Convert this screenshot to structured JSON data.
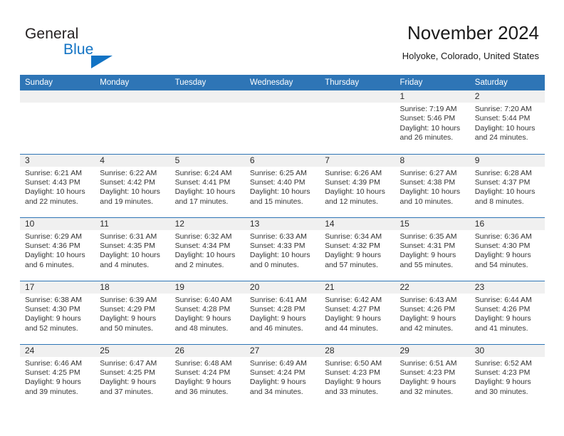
{
  "brand": {
    "name_part1": "General",
    "name_part2": "Blue",
    "triangle_icon": "blue-triangle-logo-mark",
    "accent_color": "#1273c4"
  },
  "header": {
    "title": "November 2024",
    "location": "Holyoke, Colorado, United States",
    "header_bg_color": "#2e75b6",
    "daynum_bg_color": "#f0f0f0"
  },
  "weekdays": [
    "Sunday",
    "Monday",
    "Tuesday",
    "Wednesday",
    "Thursday",
    "Friday",
    "Saturday"
  ],
  "weeks": [
    [
      {
        "day": "",
        "sunrise": "",
        "sunset": "",
        "daylight1": "",
        "daylight2": ""
      },
      {
        "day": "",
        "sunrise": "",
        "sunset": "",
        "daylight1": "",
        "daylight2": ""
      },
      {
        "day": "",
        "sunrise": "",
        "sunset": "",
        "daylight1": "",
        "daylight2": ""
      },
      {
        "day": "",
        "sunrise": "",
        "sunset": "",
        "daylight1": "",
        "daylight2": ""
      },
      {
        "day": "",
        "sunrise": "",
        "sunset": "",
        "daylight1": "",
        "daylight2": ""
      },
      {
        "day": "1",
        "sunrise": "Sunrise: 7:19 AM",
        "sunset": "Sunset: 5:46 PM",
        "daylight1": "Daylight: 10 hours",
        "daylight2": "and 26 minutes."
      },
      {
        "day": "2",
        "sunrise": "Sunrise: 7:20 AM",
        "sunset": "Sunset: 5:44 PM",
        "daylight1": "Daylight: 10 hours",
        "daylight2": "and 24 minutes."
      }
    ],
    [
      {
        "day": "3",
        "sunrise": "Sunrise: 6:21 AM",
        "sunset": "Sunset: 4:43 PM",
        "daylight1": "Daylight: 10 hours",
        "daylight2": "and 22 minutes."
      },
      {
        "day": "4",
        "sunrise": "Sunrise: 6:22 AM",
        "sunset": "Sunset: 4:42 PM",
        "daylight1": "Daylight: 10 hours",
        "daylight2": "and 19 minutes."
      },
      {
        "day": "5",
        "sunrise": "Sunrise: 6:24 AM",
        "sunset": "Sunset: 4:41 PM",
        "daylight1": "Daylight: 10 hours",
        "daylight2": "and 17 minutes."
      },
      {
        "day": "6",
        "sunrise": "Sunrise: 6:25 AM",
        "sunset": "Sunset: 4:40 PM",
        "daylight1": "Daylight: 10 hours",
        "daylight2": "and 15 minutes."
      },
      {
        "day": "7",
        "sunrise": "Sunrise: 6:26 AM",
        "sunset": "Sunset: 4:39 PM",
        "daylight1": "Daylight: 10 hours",
        "daylight2": "and 12 minutes."
      },
      {
        "day": "8",
        "sunrise": "Sunrise: 6:27 AM",
        "sunset": "Sunset: 4:38 PM",
        "daylight1": "Daylight: 10 hours",
        "daylight2": "and 10 minutes."
      },
      {
        "day": "9",
        "sunrise": "Sunrise: 6:28 AM",
        "sunset": "Sunset: 4:37 PM",
        "daylight1": "Daylight: 10 hours",
        "daylight2": "and 8 minutes."
      }
    ],
    [
      {
        "day": "10",
        "sunrise": "Sunrise: 6:29 AM",
        "sunset": "Sunset: 4:36 PM",
        "daylight1": "Daylight: 10 hours",
        "daylight2": "and 6 minutes."
      },
      {
        "day": "11",
        "sunrise": "Sunrise: 6:31 AM",
        "sunset": "Sunset: 4:35 PM",
        "daylight1": "Daylight: 10 hours",
        "daylight2": "and 4 minutes."
      },
      {
        "day": "12",
        "sunrise": "Sunrise: 6:32 AM",
        "sunset": "Sunset: 4:34 PM",
        "daylight1": "Daylight: 10 hours",
        "daylight2": "and 2 minutes."
      },
      {
        "day": "13",
        "sunrise": "Sunrise: 6:33 AM",
        "sunset": "Sunset: 4:33 PM",
        "daylight1": "Daylight: 10 hours",
        "daylight2": "and 0 minutes."
      },
      {
        "day": "14",
        "sunrise": "Sunrise: 6:34 AM",
        "sunset": "Sunset: 4:32 PM",
        "daylight1": "Daylight: 9 hours",
        "daylight2": "and 57 minutes."
      },
      {
        "day": "15",
        "sunrise": "Sunrise: 6:35 AM",
        "sunset": "Sunset: 4:31 PM",
        "daylight1": "Daylight: 9 hours",
        "daylight2": "and 55 minutes."
      },
      {
        "day": "16",
        "sunrise": "Sunrise: 6:36 AM",
        "sunset": "Sunset: 4:30 PM",
        "daylight1": "Daylight: 9 hours",
        "daylight2": "and 54 minutes."
      }
    ],
    [
      {
        "day": "17",
        "sunrise": "Sunrise: 6:38 AM",
        "sunset": "Sunset: 4:30 PM",
        "daylight1": "Daylight: 9 hours",
        "daylight2": "and 52 minutes."
      },
      {
        "day": "18",
        "sunrise": "Sunrise: 6:39 AM",
        "sunset": "Sunset: 4:29 PM",
        "daylight1": "Daylight: 9 hours",
        "daylight2": "and 50 minutes."
      },
      {
        "day": "19",
        "sunrise": "Sunrise: 6:40 AM",
        "sunset": "Sunset: 4:28 PM",
        "daylight1": "Daylight: 9 hours",
        "daylight2": "and 48 minutes."
      },
      {
        "day": "20",
        "sunrise": "Sunrise: 6:41 AM",
        "sunset": "Sunset: 4:28 PM",
        "daylight1": "Daylight: 9 hours",
        "daylight2": "and 46 minutes."
      },
      {
        "day": "21",
        "sunrise": "Sunrise: 6:42 AM",
        "sunset": "Sunset: 4:27 PM",
        "daylight1": "Daylight: 9 hours",
        "daylight2": "and 44 minutes."
      },
      {
        "day": "22",
        "sunrise": "Sunrise: 6:43 AM",
        "sunset": "Sunset: 4:26 PM",
        "daylight1": "Daylight: 9 hours",
        "daylight2": "and 42 minutes."
      },
      {
        "day": "23",
        "sunrise": "Sunrise: 6:44 AM",
        "sunset": "Sunset: 4:26 PM",
        "daylight1": "Daylight: 9 hours",
        "daylight2": "and 41 minutes."
      }
    ],
    [
      {
        "day": "24",
        "sunrise": "Sunrise: 6:46 AM",
        "sunset": "Sunset: 4:25 PM",
        "daylight1": "Daylight: 9 hours",
        "daylight2": "and 39 minutes."
      },
      {
        "day": "25",
        "sunrise": "Sunrise: 6:47 AM",
        "sunset": "Sunset: 4:25 PM",
        "daylight1": "Daylight: 9 hours",
        "daylight2": "and 37 minutes."
      },
      {
        "day": "26",
        "sunrise": "Sunrise: 6:48 AM",
        "sunset": "Sunset: 4:24 PM",
        "daylight1": "Daylight: 9 hours",
        "daylight2": "and 36 minutes."
      },
      {
        "day": "27",
        "sunrise": "Sunrise: 6:49 AM",
        "sunset": "Sunset: 4:24 PM",
        "daylight1": "Daylight: 9 hours",
        "daylight2": "and 34 minutes."
      },
      {
        "day": "28",
        "sunrise": "Sunrise: 6:50 AM",
        "sunset": "Sunset: 4:23 PM",
        "daylight1": "Daylight: 9 hours",
        "daylight2": "and 33 minutes."
      },
      {
        "day": "29",
        "sunrise": "Sunrise: 6:51 AM",
        "sunset": "Sunset: 4:23 PM",
        "daylight1": "Daylight: 9 hours",
        "daylight2": "and 32 minutes."
      },
      {
        "day": "30",
        "sunrise": "Sunrise: 6:52 AM",
        "sunset": "Sunset: 4:23 PM",
        "daylight1": "Daylight: 9 hours",
        "daylight2": "and 30 minutes."
      }
    ]
  ]
}
